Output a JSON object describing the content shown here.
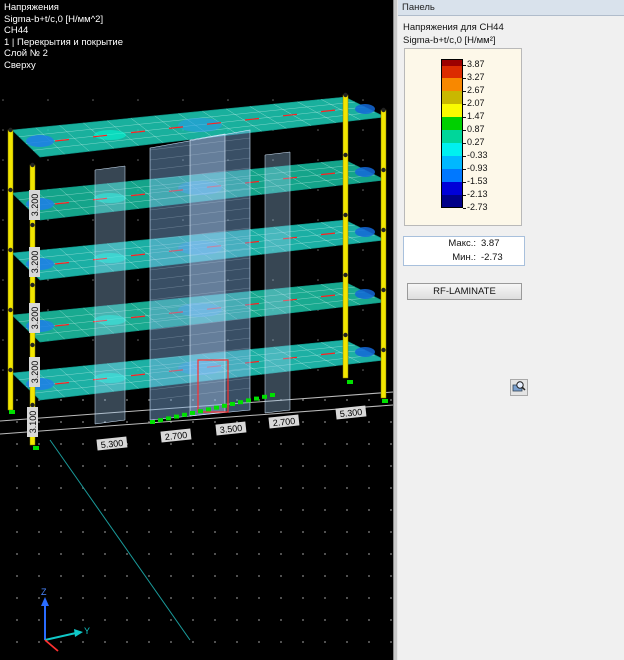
{
  "viewport": {
    "info_lines": [
      "Напряжения",
      "Sigma-b+t/c,0 [Н/мм^2]",
      "СН44",
      "1 | Перекрытия и покрытие",
      "Слой № 2",
      "Сверху"
    ],
    "dimensions_x": [
      "5.300",
      "2.700",
      "3.500",
      "2.700",
      "5.300"
    ],
    "dimensions_z": [
      "3.200",
      "3.200",
      "3.200",
      "3.200",
      "3.100"
    ],
    "axis_labels": {
      "z": "Z",
      "y": "Y"
    }
  },
  "panel": {
    "title": "Панель",
    "heading": "Напряжения для СН44",
    "unit": "Sigma-b+t/c,0 [Н/мм²]",
    "legend": [
      {
        "value": "3.87",
        "color": "#9c0000"
      },
      {
        "value": "3.27",
        "color": "#dc2b00"
      },
      {
        "value": "2.67",
        "color": "#f88800"
      },
      {
        "value": "2.07",
        "color": "#c9b800"
      },
      {
        "value": "1.47",
        "color": "#fafa00"
      },
      {
        "value": "0.87",
        "color": "#00d000"
      },
      {
        "value": "0.27",
        "color": "#00d69a"
      },
      {
        "value": "-0.33",
        "color": "#00f0f0"
      },
      {
        "value": "-0.93",
        "color": "#00b8ff"
      },
      {
        "value": "-1.53",
        "color": "#0078ff"
      },
      {
        "value": "-2.13",
        "color": "#0000d8"
      },
      {
        "value": "-2.73",
        "color": "#000088"
      }
    ],
    "stats": {
      "max_label": "Макс.:",
      "max_value": "3.87",
      "min_label": "Мин.:",
      "min_value": "-2.73"
    },
    "rf_button_label": "RF-LAMINATE"
  }
}
